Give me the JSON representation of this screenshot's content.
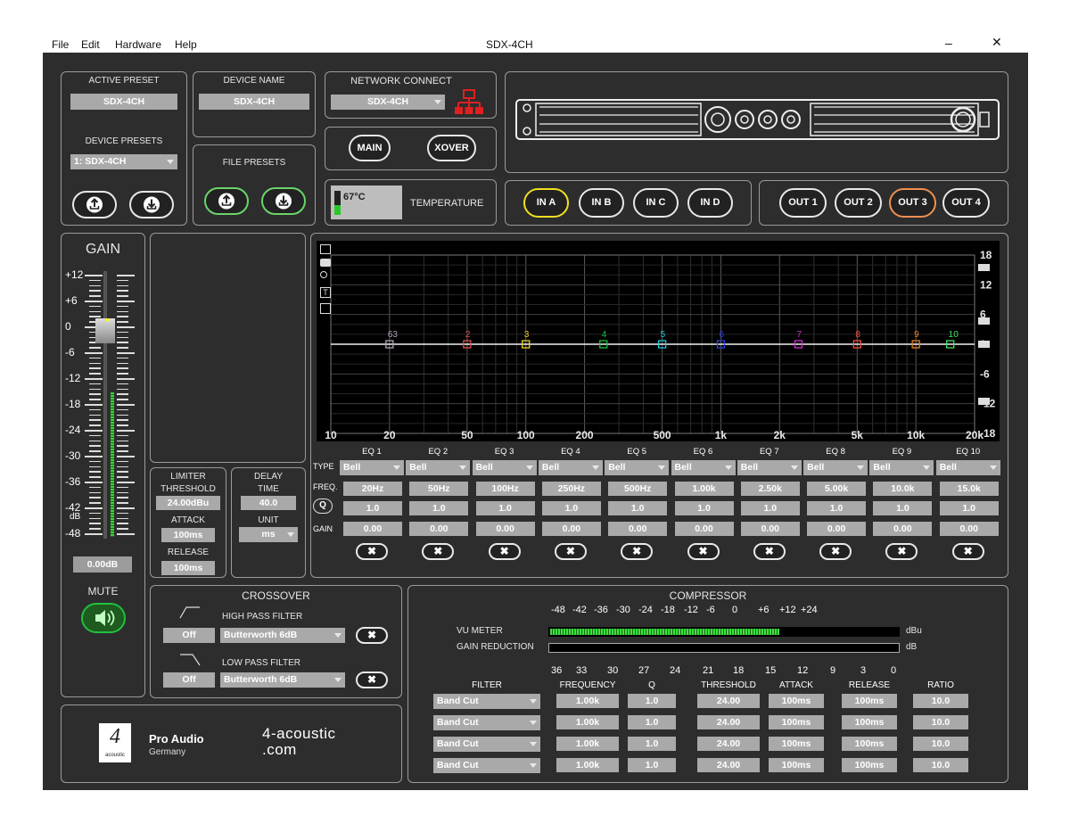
{
  "window": {
    "title": "SDX-4CH",
    "menu": [
      "File",
      "Edit",
      "Hardware",
      "Help"
    ],
    "min": "–",
    "close": "✕"
  },
  "preset": {
    "active_label": "ACTIVE PRESET",
    "active_value": "SDX-4CH",
    "device_presets_label": "DEVICE PRESETS",
    "device_preset_value": "1:  SDX-4CH",
    "device_name_label": "DEVICE NAME",
    "device_name_value": "SDX-4CH",
    "file_presets_label": "FILE PRESETS"
  },
  "network": {
    "label": "NETWORK CONNECT",
    "value": "SDX-4CH",
    "main": "MAIN",
    "xover": "XOVER"
  },
  "temperature": {
    "value": "67°C",
    "label": "TEMPERATURE"
  },
  "inputs": [
    "IN A",
    "IN B",
    "IN C",
    "IN D"
  ],
  "outputs": [
    "OUT 1",
    "OUT 2",
    "OUT 3",
    "OUT 4"
  ],
  "gain": {
    "title": "GAIN",
    "scale": [
      "+12",
      "+6",
      "0",
      "-6",
      "-12",
      "-18",
      "-24",
      "-30",
      "-36",
      "-42",
      "-48"
    ],
    "db": "dB",
    "value": "0.00dB",
    "mute": "MUTE"
  },
  "limiter": {
    "title": "LIMITER",
    "threshold_label": "THRESHOLD",
    "threshold": "24.00dBu",
    "attack_label": "ATTACK",
    "attack": "100ms",
    "release_label": "RELEASE",
    "release": "100ms"
  },
  "delay": {
    "title": "DELAY",
    "time_label": "TIME",
    "time": "40.0",
    "unit_label": "UNIT",
    "unit": "ms"
  },
  "eq": {
    "x_ticks": [
      "10",
      "20",
      "50",
      "100",
      "200",
      "500",
      "1k",
      "2k",
      "5k",
      "10k",
      "20k"
    ],
    "y_ticks": [
      "18",
      "12",
      "6",
      "0",
      "-6",
      "-12",
      "-18"
    ],
    "points": [
      {
        "label": "63",
        "color": "#b0a0b8",
        "freq": 20
      },
      {
        "label": "2",
        "color": "#e05050",
        "freq": 50
      },
      {
        "label": "3",
        "color": "#e8d020",
        "freq": 100
      },
      {
        "label": "4",
        "color": "#20c040",
        "freq": 250
      },
      {
        "label": "5",
        "color": "#20c8d8",
        "freq": 500
      },
      {
        "label": "6",
        "color": "#3040e0",
        "freq": 1000
      },
      {
        "label": "7",
        "color": "#d030d0",
        "freq": 2500
      },
      {
        "label": "8",
        "color": "#f05040",
        "freq": 5000
      },
      {
        "label": "9",
        "color": "#e08020",
        "freq": 10000
      },
      {
        "label": "10",
        "color": "#40e060",
        "freq": 15000
      }
    ],
    "row_labels": {
      "type": "TYPE",
      "freq": "FREQ.",
      "q": "Q",
      "gain": "GAIN"
    },
    "bands": [
      {
        "name": "EQ 1",
        "type": "Bell",
        "freq": "20Hz",
        "q": "1.0",
        "gain": "0.00"
      },
      {
        "name": "EQ 2",
        "type": "Bell",
        "freq": "50Hz",
        "q": "1.0",
        "gain": "0.00"
      },
      {
        "name": "EQ 3",
        "type": "Bell",
        "freq": "100Hz",
        "q": "1.0",
        "gain": "0.00"
      },
      {
        "name": "EQ 4",
        "type": "Bell",
        "freq": "250Hz",
        "q": "1.0",
        "gain": "0.00"
      },
      {
        "name": "EQ 5",
        "type": "Bell",
        "freq": "500Hz",
        "q": "1.0",
        "gain": "0.00"
      },
      {
        "name": "EQ 6",
        "type": "Bell",
        "freq": "1.00k",
        "q": "1.0",
        "gain": "0.00"
      },
      {
        "name": "EQ 7",
        "type": "Bell",
        "freq": "2.50k",
        "q": "1.0",
        "gain": "0.00"
      },
      {
        "name": "EQ 8",
        "type": "Bell",
        "freq": "5.00k",
        "q": "1.0",
        "gain": "0.00"
      },
      {
        "name": "EQ 9",
        "type": "Bell",
        "freq": "10.0k",
        "q": "1.0",
        "gain": "0.00"
      },
      {
        "name": "EQ 10",
        "type": "Bell",
        "freq": "15.0k",
        "q": "1.0",
        "gain": "0.00"
      }
    ]
  },
  "crossover": {
    "title": "CROSSOVER",
    "hpf_label": "HIGH PASS FILTER",
    "hpf_state": "Off",
    "hpf_type": "Butterworth 6dB",
    "lpf_label": "LOW PASS FILTER",
    "lpf_state": "Off",
    "lpf_type": "Butterworth 6dB"
  },
  "compressor": {
    "title": "COMPRESSOR",
    "vu_scale": [
      "-48",
      "-42",
      "-36",
      "-30",
      "-24",
      "-18",
      "-12",
      "-6",
      "0",
      "+6",
      "+12",
      "+24"
    ],
    "vu_label": "VU METER",
    "vu_unit": "dBu",
    "vu_level": 0.66,
    "gr_label": "GAIN REDUCTION",
    "gr_unit": "dB",
    "gr_scale": [
      "36",
      "33",
      "30",
      "27",
      "24",
      "21",
      "18",
      "15",
      "12",
      "9",
      "3",
      "0"
    ],
    "headers": [
      "FILTER",
      "FREQUENCY",
      "Q",
      "THRESHOLD",
      "ATTACK",
      "RELEASE",
      "RATIO"
    ],
    "rows": [
      [
        "Band Cut",
        "1.00k",
        "1.0",
        "24.00",
        "100ms",
        "100ms",
        "10.0"
      ],
      [
        "Band Cut",
        "1.00k",
        "1.0",
        "24.00",
        "100ms",
        "100ms",
        "10.0"
      ],
      [
        "Band Cut",
        "1.00k",
        "1.0",
        "24.00",
        "100ms",
        "100ms",
        "10.0"
      ],
      [
        "Band Cut",
        "1.00k",
        "1.0",
        "24.00",
        "100ms",
        "100ms",
        "10.0"
      ]
    ]
  },
  "brand": {
    "logo": "4",
    "logo_sub": "acoustic",
    "name": "Pro Audio",
    "country": "Germany",
    "url_line1": "4-acoustic",
    "url_line2": ".com"
  }
}
